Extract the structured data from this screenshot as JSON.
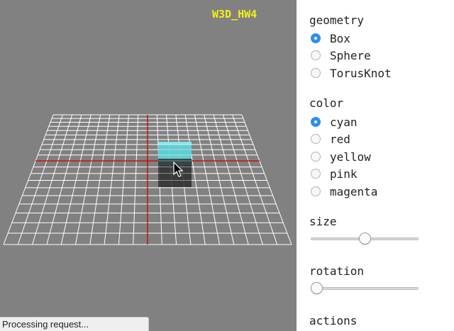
{
  "viewport": {
    "title": "W3D_HW4",
    "title_color": "#f2ee17",
    "background": "#818181",
    "grid_color": "#ffffff",
    "axis_color": "#cc0000",
    "cube_color": "#5fd3d8",
    "status": "Processing request..."
  },
  "panel": {
    "geometry": {
      "title": "geometry",
      "options": [
        {
          "label": "Box",
          "checked": true
        },
        {
          "label": "Sphere",
          "checked": false
        },
        {
          "label": "TorusKnot",
          "checked": false
        }
      ]
    },
    "color": {
      "title": "color",
      "options": [
        {
          "label": "cyan",
          "checked": true
        },
        {
          "label": "red",
          "checked": false
        },
        {
          "label": "yellow",
          "checked": false
        },
        {
          "label": "pink",
          "checked": false
        },
        {
          "label": "magenta",
          "checked": false
        }
      ]
    },
    "size": {
      "title": "size",
      "value": 0.5
    },
    "rotation": {
      "title": "rotation",
      "value": 0.0
    },
    "actions": {
      "title": "actions"
    }
  }
}
